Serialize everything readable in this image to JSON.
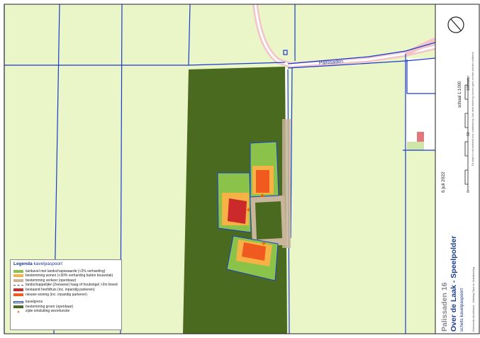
{
  "map": {
    "street_label": "Palissaden",
    "colors": {
      "pasture": "#eaf5c8",
      "parcel_green": "#4a6b1f",
      "tuinkavel": "#8bc34a",
      "wonen": "#f7b246",
      "verkeer": "#c8b59a",
      "hoofdhuis": "#cc2a2a",
      "woning": "#f05a1e",
      "kavelgrens": "#1a3ccc",
      "road_pink": "#f3c3c8",
      "building_red": "#e07880"
    }
  },
  "legend": {
    "title": "Legenda",
    "title_suffix": "kavelpaspoort",
    "items": [
      {
        "label": "tuinkavel met landschapswaarde (<2% verharding)",
        "swatch": "#8bc34a",
        "kind": "fill"
      },
      {
        "label": "bestemming wonen (<30% verharding buiten bouwvlak)",
        "swatch": "#f7b246",
        "kind": "fill"
      },
      {
        "label": "bestemming verkeer (openbaar)",
        "swatch": "#c8b59a",
        "kind": "fill"
      },
      {
        "label": "landschappelijke (Zeeuwse) haag of houtsingel >2m breed",
        "swatch": "#555555",
        "kind": "line"
      },
      {
        "label": "bestaand hoofdhuis (inc. inpandig parkeren)",
        "swatch": "#cc2a2a",
        "kind": "fill"
      },
      {
        "label": "nieuwe woning (inc. inpandig parkeren)",
        "swatch": "#f05a1e",
        "kind": "fill"
      },
      {
        "label": "kavelgrens",
        "swatch": "#1a3ccc",
        "kind": "outline"
      },
      {
        "label": "bestemming groen (openbaar)",
        "swatch": "#4a6b1f",
        "kind": "fill"
      },
      {
        "label": "zijde ontsluiting woonfunctie",
        "swatch": "#e56000",
        "kind": "triangle"
      }
    ]
  },
  "titleblock": {
    "address": "Palissaden 16",
    "project": "Over de Laak - Speelpolder",
    "subtitle": "schets kavelpaspoort",
    "date": "6 juli 2022",
    "scale": "schaal 1:1000",
    "scale_ticks": [
      "0",
      "50",
      "100meter"
    ],
    "credit": "Gemeente Amstelland - Afdeling Stad en Ontwikkeling",
    "disclaimer": "De kaart is niet bedoeld voor maatvoering. Aan deze tekening kunnen geen rechten worden ontleend."
  }
}
